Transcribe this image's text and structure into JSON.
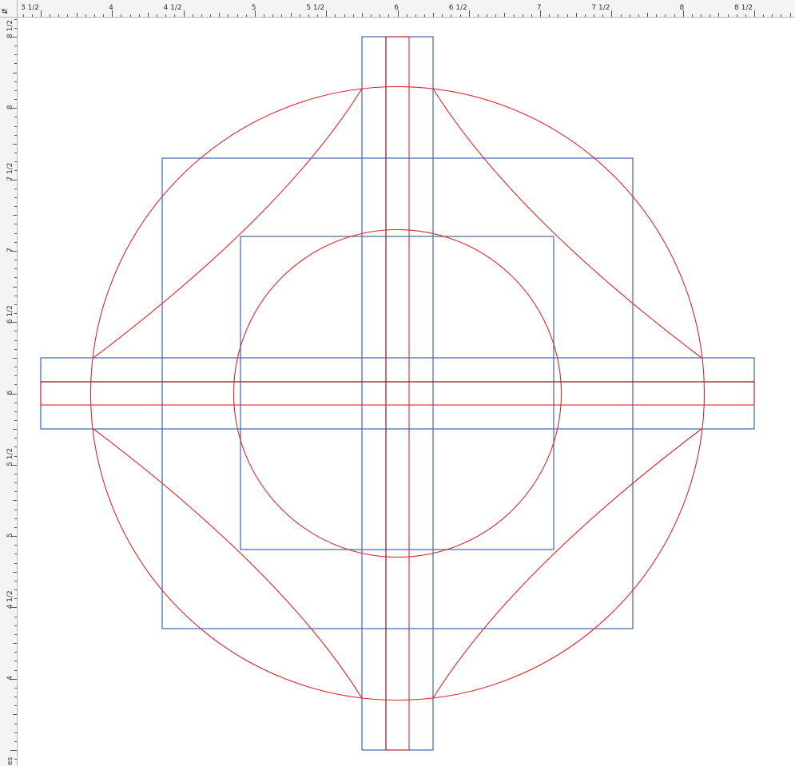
{
  "rulers": {
    "corner_glyph": "↹",
    "unit_label": "es",
    "horizontal": {
      "labels": [
        "3 1/2",
        "4",
        "4 1/2",
        "5",
        "5 1/2",
        "6",
        "6 1/2",
        "7",
        "7 1/2",
        "8",
        "8 1/2"
      ]
    },
    "vertical": {
      "labels": [
        "8 1/2",
        "8",
        "7 1/2",
        "7",
        "6 1/2",
        "6",
        "5 1/2",
        "5",
        "4 1/2",
        "4"
      ]
    }
  },
  "colors": {
    "ruler_background": "#f4f4f4",
    "guide_blue": "#4068a8",
    "construction_red": "#d8282c",
    "construction_dark_red": "#8e2424"
  }
}
